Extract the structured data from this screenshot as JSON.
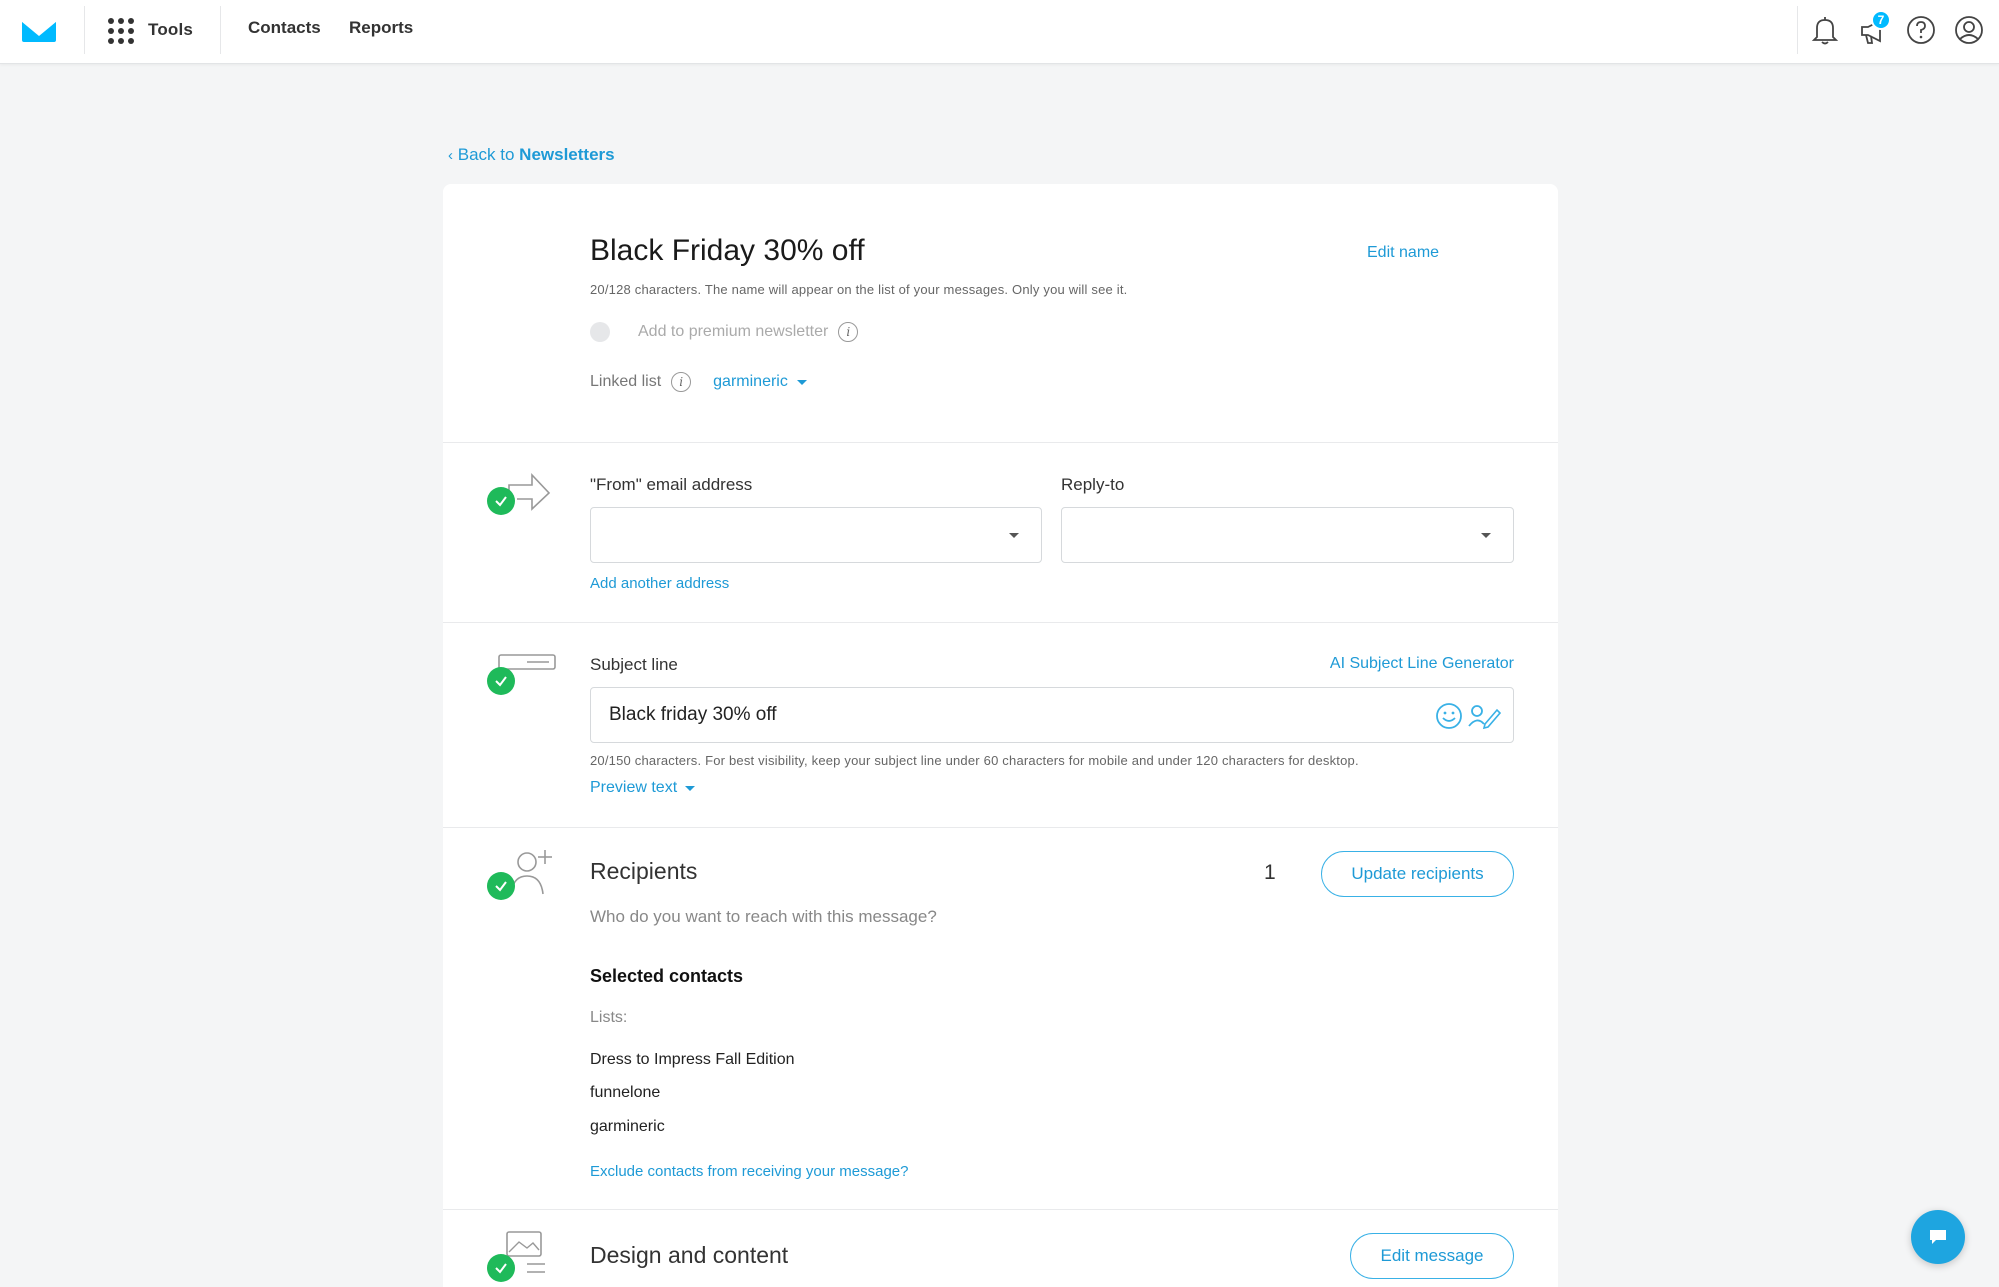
{
  "topbar": {
    "tools_label": "Tools",
    "contacts_label": "Contacts",
    "reports_label": "Reports",
    "notifications_badge": "7",
    "brand_color": "#00baff"
  },
  "back": {
    "prefix": "Back to",
    "target": "Newsletters"
  },
  "header": {
    "title": "Black Friday 30% off",
    "edit_name": "Edit name",
    "name_hint": "20/128 characters. The name will appear on the list of your messages. Only you will see it.",
    "premium_label": "Add to premium newsletter",
    "linked_list_label": "Linked list",
    "linked_list_value": "garmineric"
  },
  "from": {
    "from_label": "\"From\" email address",
    "reply_label": "Reply-to",
    "from_value": "",
    "reply_value": "",
    "add_address": "Add another address"
  },
  "subject": {
    "label": "Subject line",
    "ai_link": "AI Subject Line Generator",
    "value": "Black friday 30% off",
    "hint": "20/150 characters. For best visibility, keep your subject line under 60 characters for mobile and under 120 characters for desktop.",
    "preview_text": "Preview text"
  },
  "recipients": {
    "title": "Recipients",
    "subtitle": "Who do you want to reach with this message?",
    "count": "1",
    "update_button": "Update recipients",
    "selected_heading": "Selected contacts",
    "lists_label": "Lists:",
    "lists": [
      "Dress to Impress Fall Edition",
      "funnelone",
      "garmineric"
    ],
    "exclude_link": "Exclude contacts from receiving your message?"
  },
  "design": {
    "title": "Design and content",
    "edit_button": "Edit message"
  },
  "colors": {
    "accent": "#1e9ad6",
    "success": "#1fba5a"
  }
}
